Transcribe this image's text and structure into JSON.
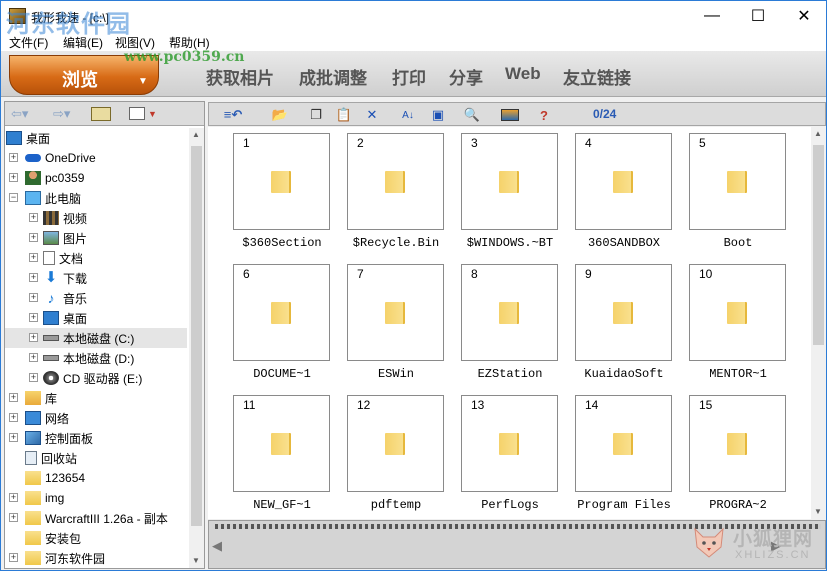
{
  "window": {
    "title": "我形我速 - [c:\\]",
    "controls": {
      "minimize": "—",
      "maximize": "☐",
      "close": "✕"
    }
  },
  "watermark": {
    "main": "河东软件园",
    "url": "www.pc0359.cn"
  },
  "menu": [
    "文件(F)",
    "编辑(E)",
    "视图(V)",
    "帮助(H)"
  ],
  "modes": {
    "active": "浏览",
    "items": [
      "获取相片",
      "成批调整",
      "打印",
      "分享",
      "Web",
      "友立链接"
    ]
  },
  "tree": [
    {
      "label": "桌面",
      "icon": "desktop-icon",
      "indent": 0,
      "toggle": ""
    },
    {
      "label": "OneDrive",
      "icon": "cloud-icon",
      "indent": 1,
      "toggle": "+"
    },
    {
      "label": "pc0359",
      "icon": "user-icon",
      "indent": 1,
      "toggle": "+"
    },
    {
      "label": "此电脑",
      "icon": "computer-icon",
      "indent": 1,
      "toggle": "−"
    },
    {
      "label": "视频",
      "icon": "video-icon",
      "indent": 2,
      "toggle": "+"
    },
    {
      "label": "图片",
      "icon": "picture-icon",
      "indent": 2,
      "toggle": "+"
    },
    {
      "label": "文档",
      "icon": "document-icon",
      "indent": 2,
      "toggle": "+"
    },
    {
      "label": "下载",
      "icon": "download-icon",
      "indent": 2,
      "toggle": "+"
    },
    {
      "label": "音乐",
      "icon": "music-icon",
      "indent": 2,
      "toggle": "+"
    },
    {
      "label": "桌面",
      "icon": "desktop-icon",
      "indent": 2,
      "toggle": "+"
    },
    {
      "label": "本地磁盘 (C:)",
      "icon": "drive-icon",
      "indent": 2,
      "toggle": "+"
    },
    {
      "label": "本地磁盘 (D:)",
      "icon": "drive-icon",
      "indent": 2,
      "toggle": "+"
    },
    {
      "label": "CD 驱动器 (E:)",
      "icon": "cd-icon",
      "indent": 2,
      "toggle": "+"
    },
    {
      "label": "库",
      "icon": "library-icon",
      "indent": 1,
      "toggle": "+"
    },
    {
      "label": "网络",
      "icon": "network-icon",
      "indent": 1,
      "toggle": "+"
    },
    {
      "label": "控制面板",
      "icon": "control-panel-icon",
      "indent": 1,
      "toggle": "+"
    },
    {
      "label": "回收站",
      "icon": "recycle-bin-icon",
      "indent": 1,
      "toggle": ""
    },
    {
      "label": "123654",
      "icon": "folder-icon",
      "indent": 1,
      "toggle": ""
    },
    {
      "label": "img",
      "icon": "folder-icon",
      "indent": 1,
      "toggle": "+"
    },
    {
      "label": "WarcraftIII 1.26a - 副本",
      "icon": "folder-icon",
      "indent": 1,
      "toggle": "+"
    },
    {
      "label": "安装包",
      "icon": "folder-icon",
      "indent": 1,
      "toggle": ""
    },
    {
      "label": "河东软件园",
      "icon": "folder-icon",
      "indent": 1,
      "toggle": "+"
    }
  ],
  "toolbar": {
    "counter": "0/24"
  },
  "thumbnails": [
    {
      "num": "1",
      "name": "$360Section"
    },
    {
      "num": "2",
      "name": "$Recycle.Bin"
    },
    {
      "num": "3",
      "name": "$WINDOWS.~BT"
    },
    {
      "num": "4",
      "name": "360SANDBOX"
    },
    {
      "num": "5",
      "name": "Boot"
    },
    {
      "num": "6",
      "name": "DOCUME~1"
    },
    {
      "num": "7",
      "name": "ESWin"
    },
    {
      "num": "8",
      "name": "EZStation"
    },
    {
      "num": "9",
      "name": "KuaidaoSoft"
    },
    {
      "num": "10",
      "name": "MENTOR~1"
    },
    {
      "num": "11",
      "name": "NEW_GF~1"
    },
    {
      "num": "12",
      "name": "pdftemp"
    },
    {
      "num": "13",
      "name": "PerfLogs"
    },
    {
      "num": "14",
      "name": "Program Files"
    },
    {
      "num": "15",
      "name": "PROGRA~2"
    }
  ],
  "corner_watermark": {
    "text": "小狐狸网",
    "sub": "XHLIZS.CN"
  }
}
